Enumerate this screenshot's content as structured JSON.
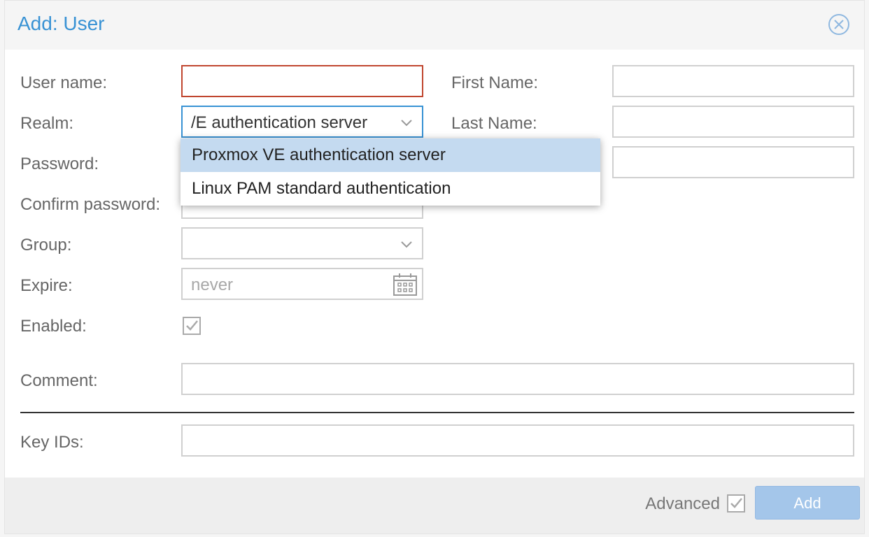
{
  "dialog": {
    "title": "Add: User"
  },
  "labels": {
    "username": "User name:",
    "realm": "Realm:",
    "password": "Password:",
    "confirm_password": "Confirm password:",
    "group": "Group:",
    "expire": "Expire:",
    "enabled": "Enabled:",
    "comment": "Comment:",
    "key_ids": "Key IDs:",
    "first_name": "First Name:",
    "last_name": "Last Name:"
  },
  "fields": {
    "username": "",
    "realm_value": "/E authentication server",
    "expire_placeholder": "never",
    "enabled_checked": true
  },
  "realm_dropdown": {
    "options": [
      "Proxmox VE authentication server",
      "Linux PAM standard authentication"
    ],
    "selected_index": 0
  },
  "footer": {
    "advanced_label": "Advanced",
    "advanced_checked": true,
    "add_button": "Add"
  },
  "colors": {
    "accent": "#3892d4",
    "invalid_border": "#c0462f",
    "selected_option_bg": "#c4daf0",
    "add_button_bg": "#a4c6ea"
  },
  "icons": [
    "close-icon",
    "chevron-down-icon",
    "calendar-icon",
    "checkmark-icon"
  ]
}
